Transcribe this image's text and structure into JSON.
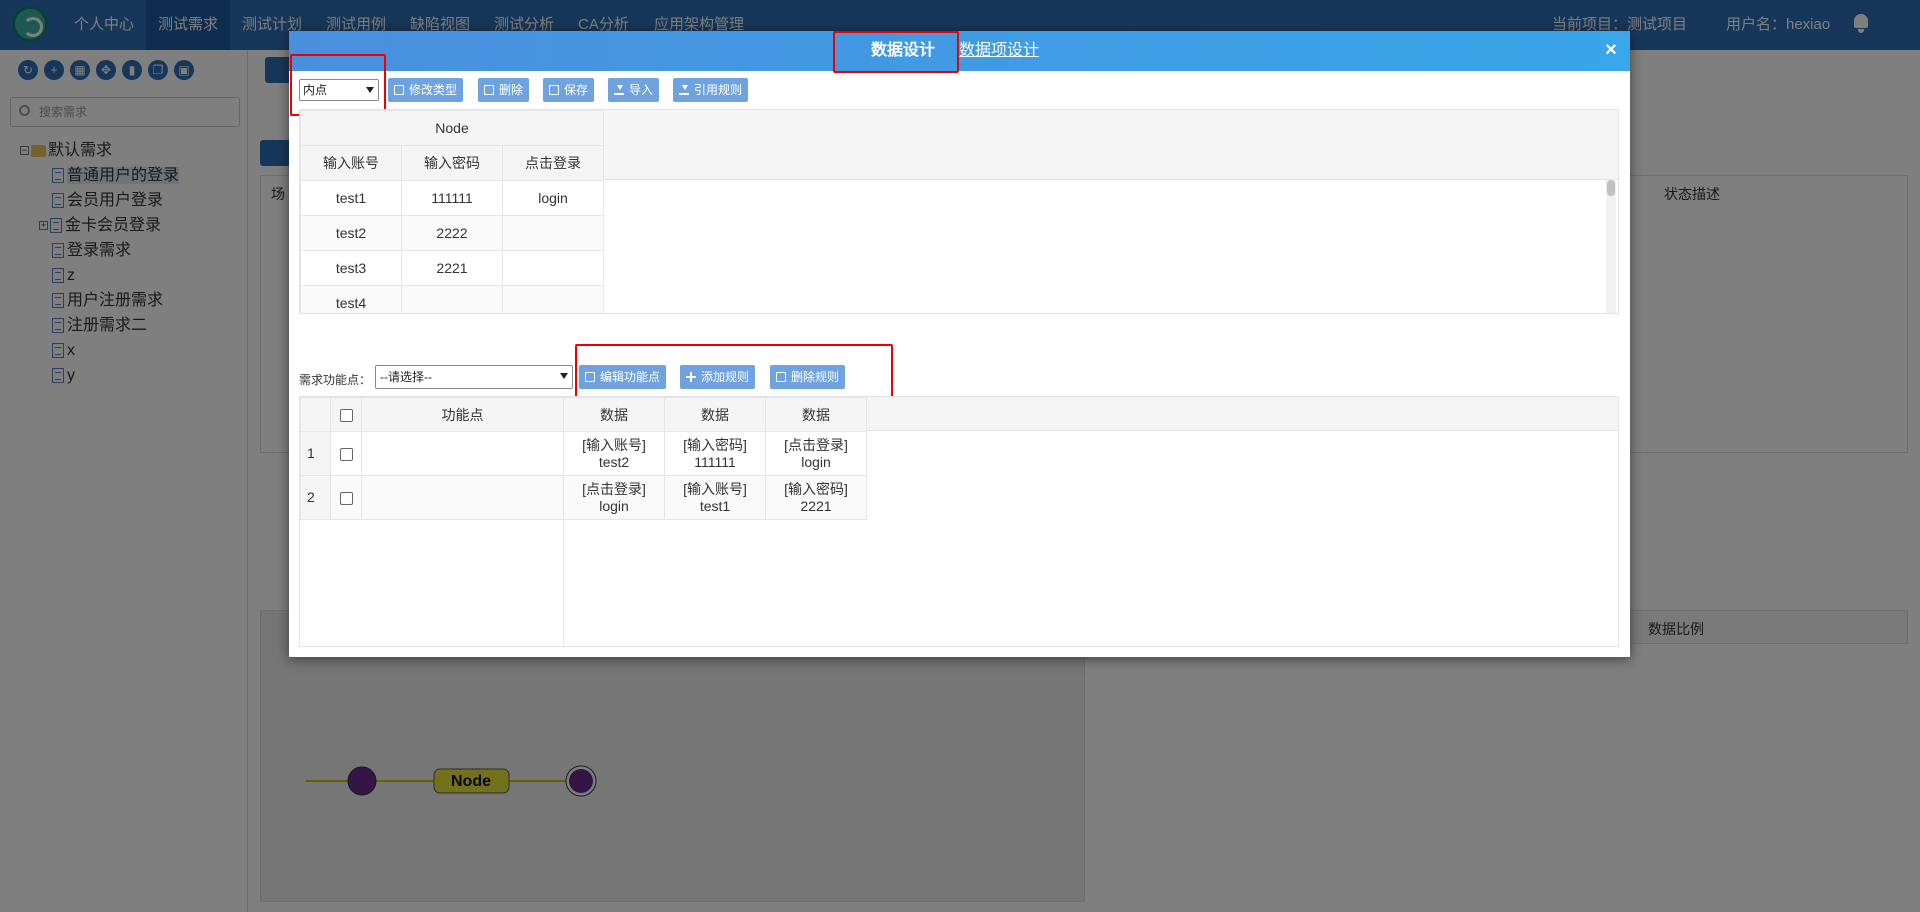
{
  "nav": {
    "items": [
      "个人中心",
      "测试需求",
      "测试计划",
      "测试用例",
      "缺陷视图",
      "测试分析",
      "CA分析",
      "应用架构管理"
    ],
    "active_index": 1,
    "project": "当前项目：测试项目",
    "user": "用户名：hexiao"
  },
  "sidebar": {
    "search_placeholder": "搜索需求",
    "tree": [
      {
        "label": "默认需求",
        "type": "folder",
        "expander": "⊟",
        "level": 0
      },
      {
        "label": "普通用户的登录",
        "type": "doc",
        "level": 1,
        "selected": true
      },
      {
        "label": "会员用户登录",
        "type": "doc",
        "level": 1
      },
      {
        "label": "金卡会员登录",
        "type": "doc",
        "level": 1,
        "expander": "⊞"
      },
      {
        "label": "登录需求",
        "type": "doc",
        "level": 1
      },
      {
        "label": "z",
        "type": "doc",
        "level": 1
      },
      {
        "label": "用户注册需求",
        "type": "doc",
        "level": 1
      },
      {
        "label": "注册需求二",
        "type": "doc",
        "level": 1
      },
      {
        "label": "x",
        "type": "doc",
        "level": 1
      },
      {
        "label": "y",
        "type": "doc",
        "level": 1
      }
    ]
  },
  "background": {
    "col_scene": "场",
    "col_status": "状态描述",
    "col_ratio": "数据比例",
    "graph_node": "Node"
  },
  "modal": {
    "tabs": {
      "active": "数据设计",
      "other": "数据项设计"
    },
    "close": "×",
    "type_select": "内点",
    "toolbar": [
      "修改类型",
      "删除",
      "保存",
      "导入",
      "引用规则"
    ],
    "upper_table": {
      "group_header": "Node",
      "columns": [
        "输入账号",
        "输入密码",
        "点击登录"
      ],
      "rows": [
        [
          "test1",
          "111111",
          "login"
        ],
        [
          "test2",
          "2222",
          ""
        ],
        [
          "test3",
          "2221",
          ""
        ],
        [
          "test4",
          "",
          ""
        ],
        [
          "",
          "",
          ""
        ]
      ]
    },
    "function_point": {
      "label": "需求功能点：",
      "select": "--请选择--",
      "buttons": [
        "编辑功能点",
        "添加规则",
        "删除规则"
      ]
    },
    "lower_table": {
      "columns": [
        "功能点",
        "数据",
        "数据",
        "数据"
      ],
      "rows": [
        {
          "index": "1",
          "fp": "",
          "cells": [
            [
              "[输入账号]",
              "test2"
            ],
            [
              "[输入密码]",
              "111111"
            ],
            [
              "[点击登录]",
              "login"
            ]
          ]
        },
        {
          "index": "2",
          "fp": "",
          "cells": [
            [
              "[点击登录]",
              "login"
            ],
            [
              "[输入账号]",
              "test1"
            ],
            [
              "[输入密码]",
              "2221"
            ]
          ]
        }
      ]
    }
  },
  "colors": {
    "nav": "#2e6fb5",
    "modal_header": "#3d9be6",
    "button": "#6fa3df",
    "highlight": "#e00000",
    "red_text": "#e02020",
    "blue_text": "#2430d8"
  }
}
